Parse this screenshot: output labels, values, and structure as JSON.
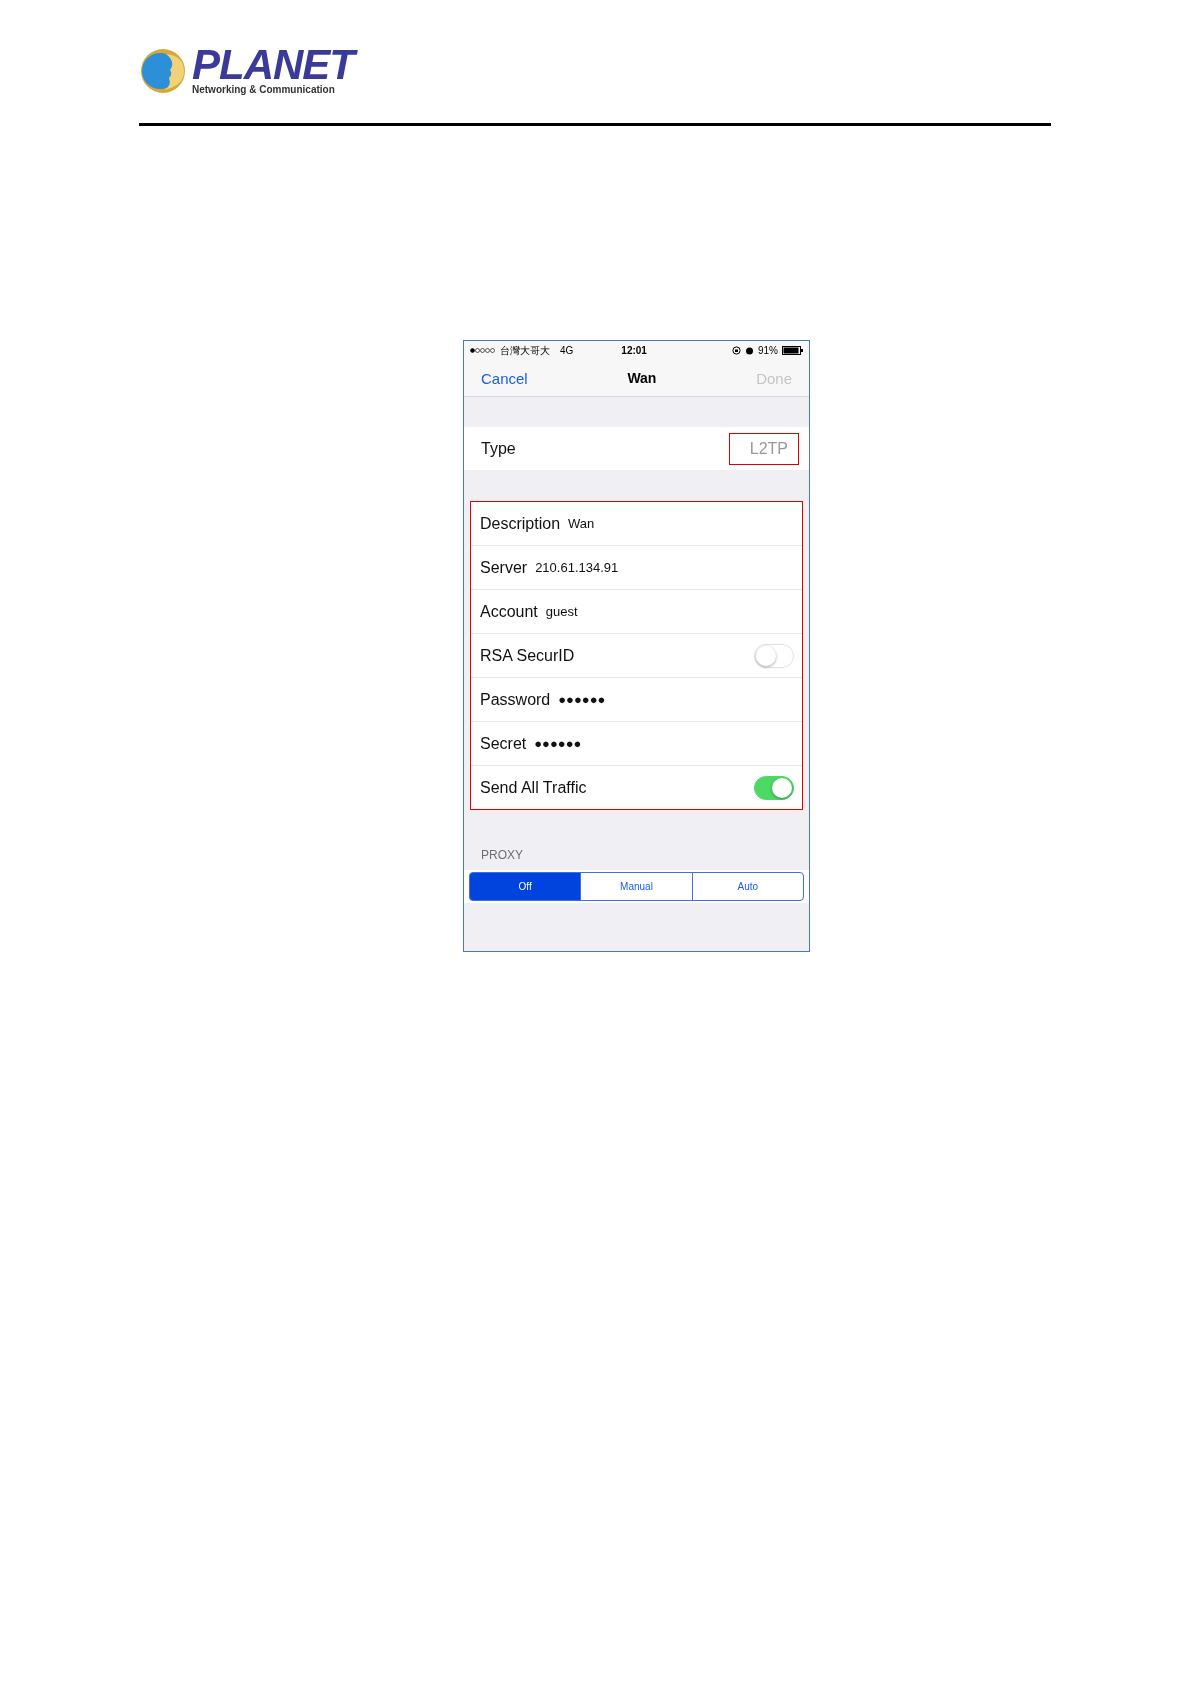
{
  "header": {
    "brand": "PLANET",
    "tagline": "Networking & Communication"
  },
  "phone": {
    "status_bar": {
      "carrier": "台灣大哥大",
      "network": "4G",
      "time": "12:01",
      "battery": "91%"
    },
    "nav": {
      "cancel": "Cancel",
      "title": "Wan",
      "done": "Done",
      "done_disabled": true
    },
    "type_row": {
      "label": "Type",
      "value": "L2TP",
      "highlighted": true
    },
    "fields_highlighted": true,
    "fields": [
      {
        "kind": "text",
        "label": "Description",
        "value": "Wan"
      },
      {
        "kind": "text",
        "label": "Server",
        "value": "210.61.134.91"
      },
      {
        "kind": "text",
        "label": "Account",
        "value": "guest"
      },
      {
        "kind": "switch",
        "label": "RSA SecurID",
        "on": false
      },
      {
        "kind": "text",
        "label": "Password",
        "value": "●●●●●●"
      },
      {
        "kind": "text",
        "label": "Secret",
        "value": "●●●●●●"
      },
      {
        "kind": "switch",
        "label": "Send All Traffic",
        "on": true
      }
    ],
    "proxy": {
      "heading": "PROXY",
      "options": [
        {
          "label": "Off",
          "selected": true
        },
        {
          "label": "Manual",
          "selected": false
        },
        {
          "label": "Auto",
          "selected": false
        }
      ]
    }
  }
}
